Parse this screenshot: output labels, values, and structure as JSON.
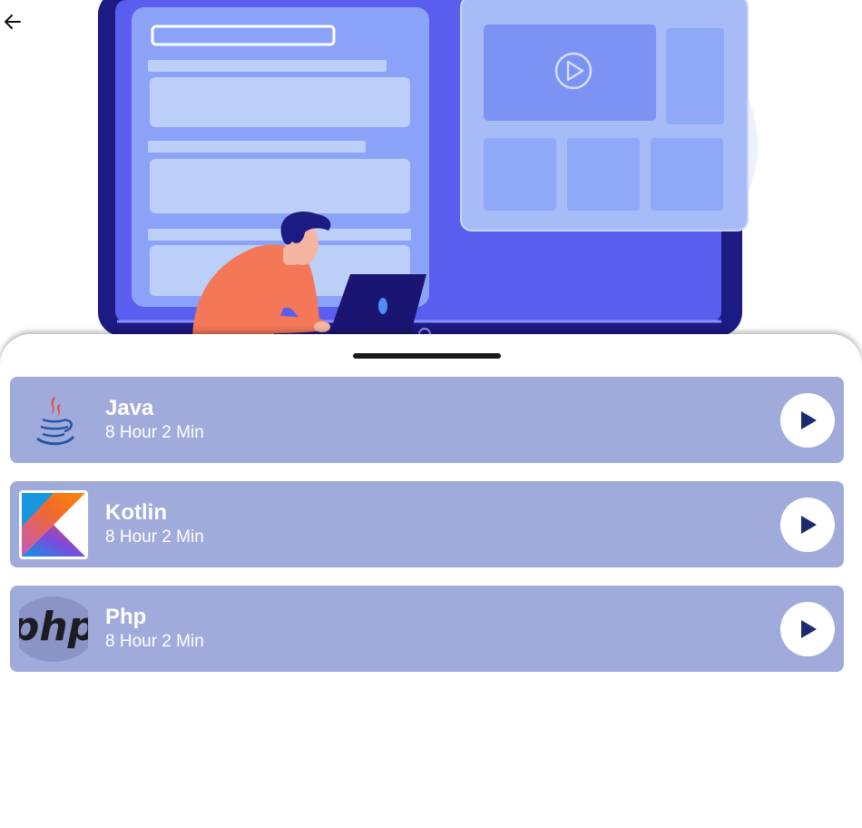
{
  "header": {
    "back_icon": "arrow-left-icon"
  },
  "hero": {
    "illustration": "developer-at-laptop-illustration"
  },
  "courses": [
    {
      "title": "Java",
      "duration": "8 Hour 2 Min",
      "logo": "java-logo",
      "action_icon": "play-icon"
    },
    {
      "title": "Kotlin",
      "duration": "8 Hour 2 Min",
      "logo": "kotlin-logo",
      "action_icon": "play-icon"
    },
    {
      "title": "Php",
      "duration": "8 Hour 2 Min",
      "logo": "php-logo",
      "action_icon": "play-icon"
    }
  ],
  "colors": {
    "card_background": "#a1abdb",
    "play_icon": "#1a2a6e",
    "monitor_frame": "#1c1a83",
    "screen": "#5a5eef"
  }
}
